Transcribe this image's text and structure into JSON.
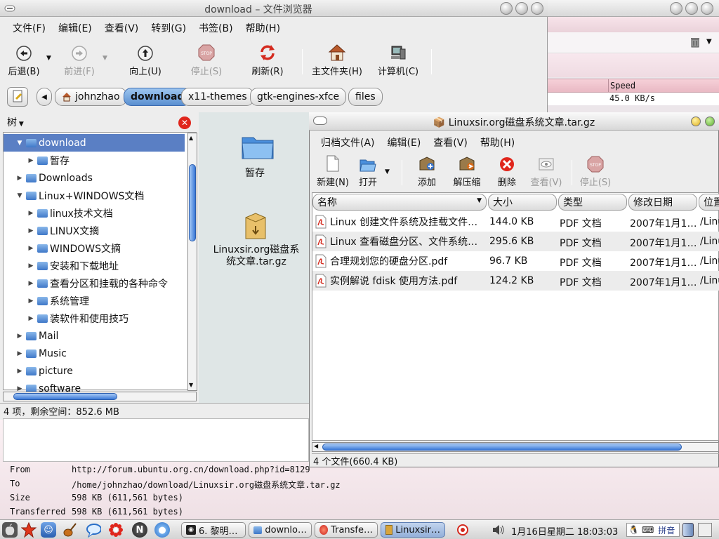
{
  "file_browser": {
    "title": "download – 文件浏览器",
    "menu": [
      "文件(F)",
      "编辑(E)",
      "查看(V)",
      "转到(G)",
      "书签(B)",
      "帮助(H)"
    ],
    "toolbar": {
      "back": "后退(B)",
      "forward": "前进(F)",
      "up": "向上(U)",
      "stop": "停止(S)",
      "reload": "刷新(R)",
      "home": "主文件夹(H)",
      "computer": "计算机(C)"
    },
    "breadcrumbs": [
      "johnzhao",
      "download",
      "x11-themes",
      "gtk-engines-xfce",
      "files"
    ],
    "sidebar_label": "树",
    "tree": [
      {
        "label": "download",
        "expanded": true,
        "selected": true
      },
      {
        "label": "暂存",
        "indent": 1
      },
      {
        "label": "Downloads",
        "indent": 0
      },
      {
        "label": "Linux+WINDOWS文档",
        "expanded": true,
        "indent": 0
      },
      {
        "label": "linux技术文档",
        "indent": 1
      },
      {
        "label": "LINUX文摘",
        "indent": 1
      },
      {
        "label": "WINDOWS文摘",
        "indent": 1
      },
      {
        "label": "安装和下载地址",
        "indent": 1
      },
      {
        "label": "查看分区和挂载的各种命令",
        "indent": 1
      },
      {
        "label": "系统管理",
        "indent": 1
      },
      {
        "label": "装软件和使用技巧",
        "indent": 1
      },
      {
        "label": "Mail",
        "indent": 0
      },
      {
        "label": "Music",
        "indent": 0
      },
      {
        "label": "picture",
        "indent": 0
      },
      {
        "label": "software",
        "indent": 0
      }
    ],
    "icons": {
      "folder_label": "暂存",
      "archive_label": "Linuxsir.org磁盘系统文章.tar.gz"
    },
    "status": "4 项，剩余空间：852.6 MB"
  },
  "archive_manager": {
    "title": "Linuxsir.org磁盘系统文章.tar.gz",
    "menu": [
      "归档文件(A)",
      "编辑(E)",
      "查看(V)",
      "帮助(H)"
    ],
    "toolbar": {
      "new": "新建(N)",
      "open": "打开",
      "add": "添加",
      "extract": "解压缩",
      "delete": "删除",
      "view": "查看(V)",
      "stop": "停止(S)"
    },
    "columns": [
      "名称",
      "大小",
      "类型",
      "修改日期",
      "位置"
    ],
    "files": [
      {
        "name": "Linux 创建文件系统及挂载文件…",
        "size": "144.0 KB",
        "type": "PDF 文档",
        "date": "2007年1月1…",
        "location": "/Linu"
      },
      {
        "name": "Linux 查看磁盘分区、文件系统…",
        "size": "295.6 KB",
        "type": "PDF 文档",
        "date": "2007年1月1…",
        "location": "/Linu"
      },
      {
        "name": "合理规划您的硬盘分区.pdf",
        "size": "96.7 KB",
        "type": "PDF 文档",
        "date": "2007年1月1…",
        "location": "/Linu"
      },
      {
        "name": "实例解说 fdisk 使用方法.pdf",
        "size": "124.2 KB",
        "type": "PDF 文档",
        "date": "2007年1月1…",
        "location": "/Linu"
      }
    ],
    "status": "4 个文件(660.4 KB)"
  },
  "transfer": {
    "speed_header": "Speed",
    "speed_value": "45.0 KB/s",
    "from_label": "From",
    "from_value": "http://forum.ubuntu.org.cn/download.php?id=8129",
    "to_label": "To",
    "to_value": "/home/johnzhao/download/Linuxsir.org磁盘系统文章.tar.gz",
    "size_label": "Size",
    "size_value": "598 KB (611,561 bytes)",
    "transferred_label": "Transferred",
    "transferred_value": "598 KB (611,561 bytes)"
  },
  "taskbar": {
    "tasks": [
      "6. 黎明…",
      "downlo…",
      "Transfe…",
      "Linuxsir…"
    ],
    "clock": "1月16日星期二 18:03:03",
    "ime": "拼音"
  }
}
